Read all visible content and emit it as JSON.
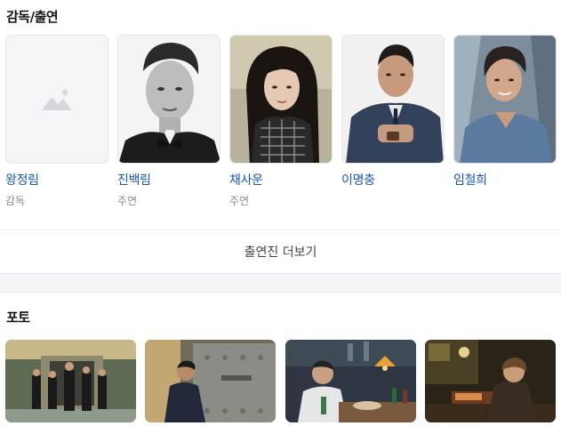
{
  "cast_section": {
    "title": "감독/출연",
    "people": [
      {
        "name": "왕정림",
        "role": "감독",
        "has_photo": false
      },
      {
        "name": "진백림",
        "role": "주연",
        "has_photo": true
      },
      {
        "name": "채사운",
        "role": "주연",
        "has_photo": true
      },
      {
        "name": "이명충",
        "role": "",
        "has_photo": true
      },
      {
        "name": "임철희",
        "role": "",
        "has_photo": true
      }
    ],
    "more_label": "출연진 더보기"
  },
  "photo_section": {
    "title": "포토",
    "photo_count": 4
  },
  "colors": {
    "name_link": "#1a55b5",
    "role_text": "#8a8a8a",
    "placeholder_bg": "#f4f5f7"
  }
}
